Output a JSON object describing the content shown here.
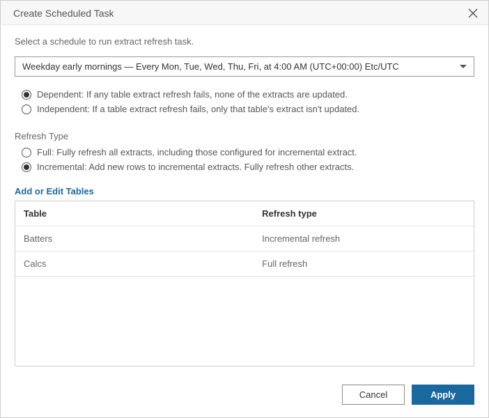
{
  "header": {
    "title": "Create Scheduled Task"
  },
  "prompt": "Select a schedule to run extract refresh task.",
  "schedule": {
    "selected": "Weekday early mornings — Every Mon, Tue, Wed, Thu, Fri, at 4:00 AM (UTC+00:00) Etc/UTC"
  },
  "dependency": {
    "options": [
      {
        "label": "Dependent: If any table extract refresh fails, none of the extracts are updated.",
        "selected": true
      },
      {
        "label": "Independent: If a table extract refresh fails, only that table's extract isn't updated.",
        "selected": false
      }
    ]
  },
  "refresh_type": {
    "heading": "Refresh Type",
    "options": [
      {
        "label": "Full: Fully refresh all extracts, including those configured for incremental extract.",
        "selected": false
      },
      {
        "label": "Incremental: Add new rows to incremental extracts. Fully refresh other extracts.",
        "selected": true
      }
    ]
  },
  "tables": {
    "link": "Add or Edit Tables",
    "columns": {
      "table": "Table",
      "type": "Refresh type"
    },
    "rows": [
      {
        "name": "Batters",
        "type": "Incremental refresh"
      },
      {
        "name": "Calcs",
        "type": "Full refresh"
      }
    ]
  },
  "footer": {
    "cancel": "Cancel",
    "apply": "Apply"
  }
}
